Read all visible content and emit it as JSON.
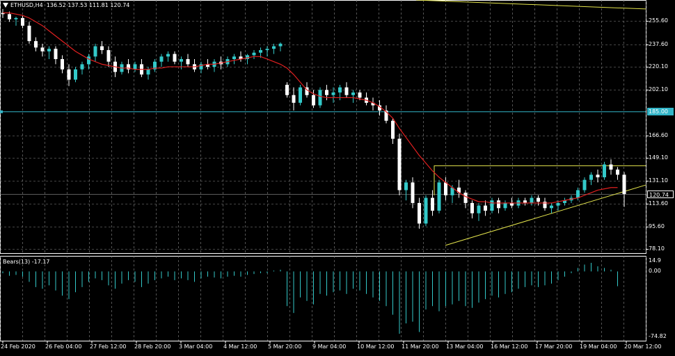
{
  "header": {
    "symbol": "ETHUSD,H4",
    "ohlc": "136.52 137.53 111.81 120.74"
  },
  "indicator": {
    "label": "Bears(13) -17.17",
    "scale_top": "14.9",
    "scale_zero": "0.00",
    "scale_bottom": "-74.82"
  },
  "price_axis": [
    "255.60",
    "237.60",
    "220.10",
    "202.10",
    "166.60",
    "149.10",
    "131.10",
    "113.60",
    "95.60",
    "78.10"
  ],
  "price_tags": {
    "level_line": "185.00",
    "current": "120.74"
  },
  "time_axis": [
    "24 Feb 2020",
    "26 Feb 04:00",
    "27 Feb 12:00",
    "28 Feb 20:00",
    "3 Mar 04:00",
    "4 Mar 12:00",
    "5 Mar 20:00",
    "9 Mar 04:00",
    "10 Mar 12:00",
    "11 Mar 20:00",
    "13 Mar 04:00",
    "16 Mar 12:00",
    "17 Mar 20:00",
    "19 Mar 04:00",
    "20 Mar 12:00"
  ],
  "colors": {
    "bull": "#33c9c9",
    "bear": "#ffffff",
    "ma": "#e02020",
    "trend": "#e6e64d",
    "grid": "#8a8a8a",
    "level": "#33b5c8"
  },
  "chart_data": {
    "type": "candlestick",
    "title": "ETHUSD,H4",
    "ylim": [
      75,
      272
    ],
    "indicator_ylim": [
      -80,
      18
    ],
    "candles": [
      [
        262,
        265,
        258,
        261
      ],
      [
        261,
        263,
        255,
        257
      ],
      [
        257,
        259,
        252,
        258
      ],
      [
        258,
        260,
        250,
        252
      ],
      [
        252,
        255,
        238,
        240
      ],
      [
        240,
        243,
        232,
        235
      ],
      [
        235,
        238,
        228,
        232
      ],
      [
        232,
        236,
        226,
        234
      ],
      [
        234,
        236,
        222,
        226
      ],
      [
        226,
        229,
        215,
        218
      ],
      [
        218,
        222,
        205,
        210
      ],
      [
        210,
        220,
        208,
        218
      ],
      [
        218,
        224,
        214,
        222
      ],
      [
        222,
        230,
        218,
        228
      ],
      [
        228,
        238,
        224,
        236
      ],
      [
        236,
        240,
        230,
        233
      ],
      [
        233,
        236,
        220,
        224
      ],
      [
        224,
        228,
        212,
        216
      ],
      [
        216,
        224,
        214,
        222
      ],
      [
        222,
        226,
        215,
        218
      ],
      [
        218,
        224,
        216,
        222
      ],
      [
        222,
        226,
        212,
        214
      ],
      [
        214,
        220,
        210,
        218
      ],
      [
        218,
        226,
        216,
        224
      ],
      [
        224,
        230,
        220,
        228
      ],
      [
        228,
        232,
        224,
        230
      ],
      [
        230,
        232,
        222,
        224
      ],
      [
        224,
        228,
        218,
        226
      ],
      [
        226,
        230,
        220,
        222
      ],
      [
        222,
        226,
        216,
        218
      ],
      [
        218,
        224,
        215,
        222
      ],
      [
        222,
        226,
        218,
        220
      ],
      [
        220,
        226,
        216,
        224
      ],
      [
        224,
        228,
        218,
        222
      ],
      [
        222,
        228,
        220,
        226
      ],
      [
        226,
        230,
        222,
        228
      ],
      [
        228,
        232,
        224,
        226
      ],
      [
        226,
        230,
        222,
        229
      ],
      [
        229,
        233,
        226,
        231
      ],
      [
        231,
        235,
        227,
        233
      ],
      [
        233,
        236,
        228,
        234
      ],
      [
        234,
        238,
        230,
        236
      ],
      [
        236,
        239,
        232,
        238
      ],
      [
        206,
        208,
        196,
        198
      ],
      [
        198,
        204,
        186,
        192
      ],
      [
        192,
        206,
        190,
        204
      ],
      [
        204,
        208,
        196,
        198
      ],
      [
        198,
        202,
        188,
        190
      ],
      [
        190,
        204,
        188,
        202
      ],
      [
        202,
        206,
        194,
        198
      ],
      [
        198,
        204,
        192,
        200
      ],
      [
        200,
        206,
        194,
        204
      ],
      [
        204,
        208,
        196,
        198
      ],
      [
        198,
        202,
        192,
        200
      ],
      [
        200,
        202,
        194,
        196
      ],
      [
        196,
        200,
        190,
        192
      ],
      [
        192,
        196,
        186,
        190
      ],
      [
        190,
        194,
        182,
        186
      ],
      [
        186,
        190,
        176,
        178
      ],
      [
        178,
        180,
        160,
        164
      ],
      [
        164,
        168,
        120,
        124
      ],
      [
        124,
        132,
        116,
        130
      ],
      [
        130,
        134,
        110,
        114
      ],
      [
        114,
        118,
        94,
        98
      ],
      [
        98,
        120,
        96,
        118
      ],
      [
        118,
        124,
        104,
        108
      ],
      [
        108,
        132,
        106,
        130
      ],
      [
        130,
        134,
        116,
        120
      ],
      [
        120,
        128,
        114,
        126
      ],
      [
        126,
        132,
        118,
        122
      ],
      [
        122,
        124,
        110,
        114
      ],
      [
        114,
        116,
        102,
        106
      ],
      [
        106,
        114,
        100,
        112
      ],
      [
        112,
        116,
        104,
        108
      ],
      [
        108,
        118,
        106,
        116
      ],
      [
        116,
        118,
        106,
        110
      ],
      [
        110,
        116,
        108,
        114
      ],
      [
        114,
        118,
        110,
        112
      ],
      [
        112,
        118,
        110,
        116
      ],
      [
        116,
        118,
        112,
        114
      ],
      [
        114,
        120,
        112,
        118
      ],
      [
        118,
        120,
        112,
        115
      ],
      [
        115,
        118,
        108,
        110
      ],
      [
        110,
        114,
        106,
        112
      ],
      [
        112,
        116,
        108,
        114
      ],
      [
        114,
        118,
        112,
        116
      ],
      [
        116,
        120,
        114,
        118
      ],
      [
        118,
        126,
        116,
        124
      ],
      [
        124,
        134,
        122,
        132
      ],
      [
        132,
        138,
        128,
        136
      ],
      [
        136,
        140,
        130,
        134
      ],
      [
        134,
        146,
        132,
        144
      ],
      [
        144,
        148,
        136,
        140
      ],
      [
        140,
        142,
        132,
        136
      ],
      [
        136,
        138,
        111,
        121
      ]
    ],
    "ma": [
      262,
      262,
      261,
      260,
      258,
      255,
      252,
      248,
      244,
      240,
      236,
      232,
      229,
      226,
      224,
      222,
      221,
      220,
      219,
      219,
      218,
      218,
      218,
      219,
      219,
      220,
      220,
      220,
      220,
      220,
      221,
      222,
      222,
      223,
      224,
      225,
      226,
      227,
      228,
      228,
      226,
      224,
      222,
      219,
      214,
      208,
      202,
      199,
      197,
      196,
      196,
      196,
      196,
      196,
      195,
      194,
      192,
      189,
      185,
      180,
      172,
      165,
      158,
      151,
      145,
      139,
      134,
      130,
      126,
      122,
      119,
      117,
      115,
      115,
      114,
      114,
      114,
      114,
      114,
      114,
      114,
      114,
      114,
      114,
      115,
      116,
      117,
      118,
      120,
      122,
      124,
      125,
      126,
      126
    ],
    "bears": [
      -2,
      -5,
      -4,
      -6,
      -12,
      -18,
      -20,
      -16,
      -22,
      -28,
      -32,
      -24,
      -18,
      -12,
      -8,
      -10,
      -16,
      -20,
      -14,
      -10,
      -12,
      -18,
      -14,
      -10,
      -8,
      -6,
      -10,
      -8,
      -10,
      -12,
      -8,
      -6,
      -7,
      -8,
      -6,
      -5,
      -6,
      -4,
      -3,
      -2,
      -2,
      1,
      2,
      -40,
      -48,
      -30,
      -34,
      -38,
      -26,
      -28,
      -24,
      -22,
      -26,
      -20,
      -22,
      -26,
      -30,
      -34,
      -40,
      -50,
      -72,
      -60,
      -58,
      -70,
      -44,
      -40,
      -46,
      -40,
      -38,
      -34,
      -40,
      -42,
      -36,
      -32,
      -28,
      -30,
      -26,
      -24,
      -20,
      -18,
      -16,
      -18,
      -16,
      -14,
      -10,
      -6,
      -2,
      4,
      8,
      10,
      6,
      4,
      2,
      -17
    ]
  }
}
